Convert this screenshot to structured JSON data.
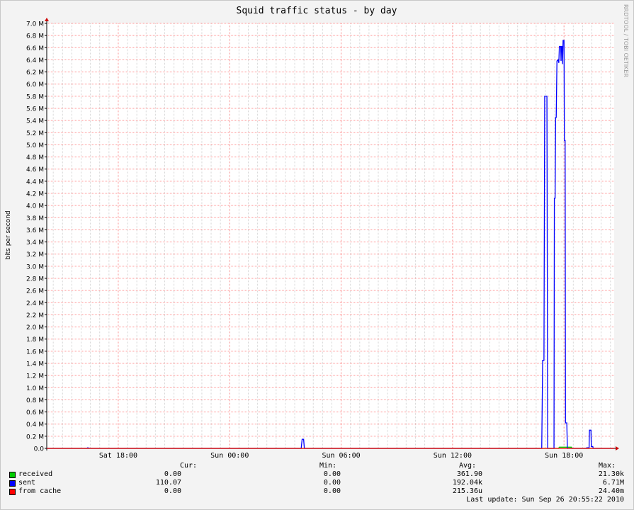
{
  "chart_data": {
    "type": "line",
    "title": "Squid traffic status - by day",
    "ylabel": "bits per second",
    "watermark": "RRDTOOL / TOBI OETIKER",
    "ylim": [
      0,
      7.0
    ],
    "y_unit": "M",
    "y_ticks": [
      "0.0",
      "0.2 M",
      "0.4 M",
      "0.6 M",
      "0.8 M",
      "1.0 M",
      "1.2 M",
      "1.4 M",
      "1.6 M",
      "1.8 M",
      "2.0 M",
      "2.2 M",
      "2.4 M",
      "2.6 M",
      "2.8 M",
      "3.0 M",
      "3.2 M",
      "3.4 M",
      "3.6 M",
      "3.8 M",
      "4.0 M",
      "4.2 M",
      "4.4 M",
      "4.6 M",
      "4.8 M",
      "5.0 M",
      "5.2 M",
      "5.4 M",
      "5.6 M",
      "5.8 M",
      "6.0 M",
      "6.2 M",
      "6.4 M",
      "6.6 M",
      "6.8 M",
      "7.0 M"
    ],
    "x_range_hours": [
      14.15,
      23.0
    ],
    "x_ticks": [
      {
        "label": "Sat 18:00",
        "hour": 18
      },
      {
        "label": "Sun 00:00",
        "hour": 24
      },
      {
        "label": "Sun 06:00",
        "hour": 30
      },
      {
        "label": "Sun 12:00",
        "hour": 36
      },
      {
        "label": "Sun 18:00",
        "hour": 42
      }
    ],
    "x_start_hour": 14.15,
    "x_end_hour": 44.7,
    "grid": true,
    "series": [
      {
        "name": "received",
        "color": "#00cc00",
        "points": [
          [
            14.15,
            0
          ],
          [
            41.7,
            0
          ],
          [
            41.75,
            0.02
          ],
          [
            42.4,
            0.02
          ],
          [
            42.45,
            0
          ],
          [
            44.7,
            0
          ]
        ]
      },
      {
        "name": "sent",
        "color": "#0000ff",
        "points": [
          [
            14.15,
            0
          ],
          [
            16.3,
            0
          ],
          [
            16.35,
            0.01
          ],
          [
            16.5,
            0
          ],
          [
            27.85,
            0
          ],
          [
            27.9,
            0.15
          ],
          [
            27.98,
            0.15
          ],
          [
            28.02,
            0
          ],
          [
            40.8,
            0
          ],
          [
            40.85,
            1.45
          ],
          [
            40.92,
            1.45
          ],
          [
            40.96,
            5.8
          ],
          [
            41.08,
            5.8
          ],
          [
            41.12,
            0
          ],
          [
            41.46,
            0
          ],
          [
            41.48,
            4.12
          ],
          [
            41.52,
            4.12
          ],
          [
            41.55,
            5.45
          ],
          [
            41.58,
            5.45
          ],
          [
            41.62,
            6.38
          ],
          [
            41.68,
            6.4
          ],
          [
            41.72,
            6.35
          ],
          [
            41.75,
            6.62
          ],
          [
            41.82,
            6.62
          ],
          [
            41.84,
            6.38
          ],
          [
            41.86,
            6.62
          ],
          [
            41.9,
            6.62
          ],
          [
            41.92,
            6.33
          ],
          [
            41.95,
            6.72
          ],
          [
            42.0,
            6.72
          ],
          [
            42.02,
            5.07
          ],
          [
            42.06,
            5.07
          ],
          [
            42.08,
            0.42
          ],
          [
            42.15,
            0.42
          ],
          [
            42.18,
            0
          ],
          [
            43.2,
            0
          ],
          [
            43.22,
            0.01
          ],
          [
            43.35,
            0.01
          ],
          [
            43.37,
            0.3
          ],
          [
            43.45,
            0.3
          ],
          [
            43.47,
            0.03
          ],
          [
            43.55,
            0.03
          ],
          [
            43.57,
            0
          ],
          [
            44.7,
            0
          ]
        ]
      },
      {
        "name": "from cache",
        "color": "#ff0000",
        "points": [
          [
            14.15,
            0
          ],
          [
            44.7,
            0
          ]
        ]
      }
    ],
    "legend_header": {
      "cur": "Cur:",
      "min": "Min:",
      "avg": "Avg:",
      "max": "Max:"
    },
    "legend_rows": [
      {
        "name": "received",
        "color": "#00cc00",
        "cur": "0.00",
        "min": "0.00",
        "avg": "361.90",
        "max": "21.30k"
      },
      {
        "name": "sent",
        "color": "#0000ff",
        "cur": "110.07",
        "min": "0.00",
        "avg": "192.04k",
        "max": "6.71M"
      },
      {
        "name": "from cache",
        "color": "#ff0000",
        "cur": "0.00",
        "min": "0.00",
        "avg": "215.36u",
        "max": "24.40m"
      }
    ],
    "last_update": "Last update: Sun Sep 26 20:55:22 2010"
  }
}
